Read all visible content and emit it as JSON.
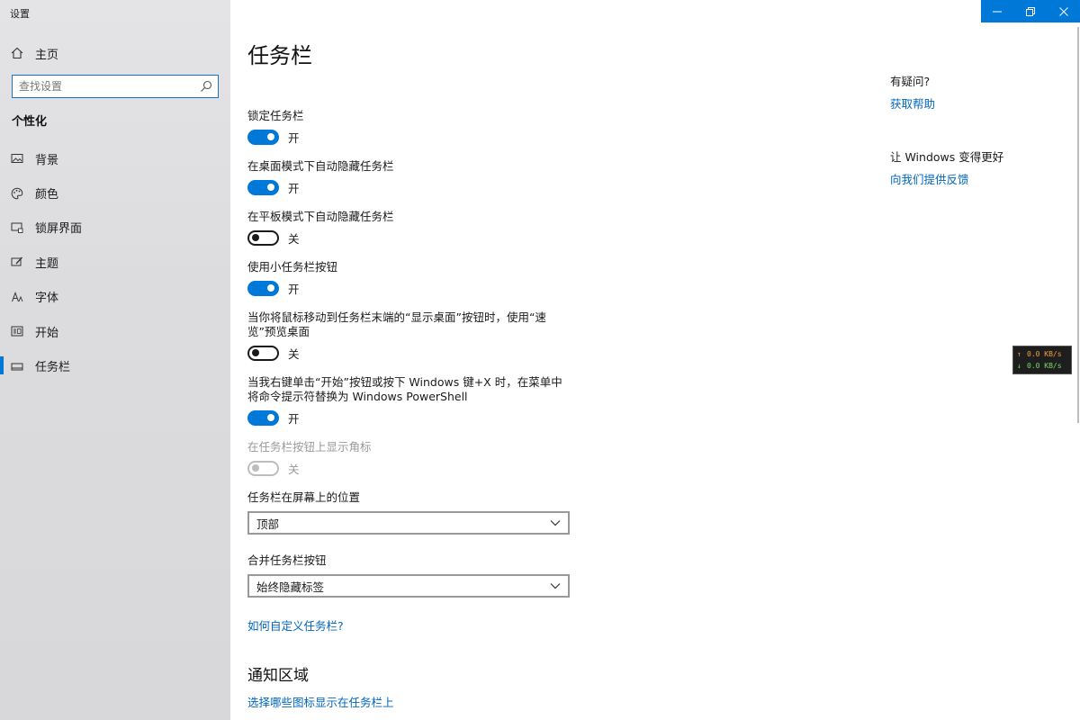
{
  "window": {
    "title": "设置"
  },
  "sidebar": {
    "home_label": "主页",
    "search_placeholder": "查找设置",
    "section_heading": "个性化",
    "items": [
      {
        "label": "背景",
        "icon": "picture-icon"
      },
      {
        "label": "颜色",
        "icon": "palette-icon"
      },
      {
        "label": "锁屏界面",
        "icon": "lock-screen-icon"
      },
      {
        "label": "主题",
        "icon": "theme-brush-icon"
      },
      {
        "label": "字体",
        "icon": "font-icon"
      },
      {
        "label": "开始",
        "icon": "start-menu-icon"
      },
      {
        "label": "任务栏",
        "icon": "taskbar-icon",
        "active": true
      }
    ]
  },
  "main": {
    "title": "任务栏",
    "settings": [
      {
        "label": "锁定任务栏",
        "state": "开",
        "on": true
      },
      {
        "label": "在桌面模式下自动隐藏任务栏",
        "state": "开",
        "on": true
      },
      {
        "label": "在平板模式下自动隐藏任务栏",
        "state": "关",
        "on": false
      },
      {
        "label": "使用小任务栏按钮",
        "state": "开",
        "on": true
      },
      {
        "label": "当你将鼠标移动到任务栏末端的“显示桌面”按钮时，使用“速览”预览桌面",
        "state": "关",
        "on": false
      },
      {
        "label": "当我右键单击“开始”按钮或按下 Windows 键+X 时，在菜单中将命令提示符替换为 Windows PowerShell",
        "state": "开",
        "on": true
      },
      {
        "label": "在任务栏按钮上显示角标",
        "state": "关",
        "on": false,
        "disabled": true
      }
    ],
    "position": {
      "label": "任务栏在屏幕上的位置",
      "value": "顶部"
    },
    "combine": {
      "label": "合并任务栏按钮",
      "value": "始终隐藏标签"
    },
    "customize_link": "如何自定义任务栏?",
    "notification_heading": "通知区域",
    "notification_link": "选择哪些图标显示在任务栏上"
  },
  "aside": {
    "question": "有疑问?",
    "help_link": "获取帮助",
    "improve_heading": "让 Windows 变得更好",
    "feedback_link": "向我们提供反馈"
  },
  "netmon": {
    "up": "0.0 KB/s",
    "down": "0.0 KB/s"
  },
  "colors": {
    "accent": "#0078d7",
    "link": "#0067c0",
    "sidebar_bg": "#dcdcde"
  }
}
